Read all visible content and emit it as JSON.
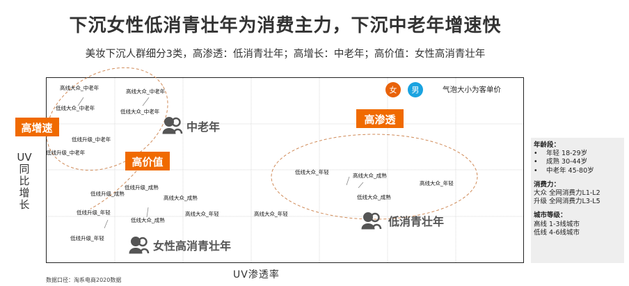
{
  "title": "下沉女性低消青壮年为消费主力，下沉中老年增速快",
  "subtitle": "美妆下沉人群细分3类，高渗透：低消青壮年；高增长：中老年；高价值：女性高消青壮年",
  "source": "数据口径：淘系电商2020数据",
  "chart_data": {
    "type": "scatter",
    "xlabel": "UV渗透率",
    "ylabel": "UV同比增长",
    "note": "气泡大小为客单价",
    "legend": [
      {
        "label": "女",
        "color": "#e8620a"
      },
      {
        "label": "男",
        "color": "#1aa3e0"
      }
    ],
    "points": [
      {
        "label": "高线大众_中老年"
      },
      {
        "label": "高线大众_中老年"
      },
      {
        "label": "低线大众_中老年"
      },
      {
        "label": "低线大众_中老年"
      },
      {
        "label": "低线升级_中老年"
      },
      {
        "label": "低线升级_中老年"
      },
      {
        "label": "低线升级_成熟"
      },
      {
        "label": "低线升级_成熟"
      },
      {
        "label": "高线大众_成熟"
      },
      {
        "label": "低线升级_年轻"
      },
      {
        "label": "高线大众_年轻"
      },
      {
        "label": "高线大众_年轻"
      },
      {
        "label": "低线大众_成熟"
      },
      {
        "label": "低线升级_年轻"
      },
      {
        "label": "低线大众_年轻"
      },
      {
        "label": "高线大众_成熟"
      },
      {
        "label": "高线大众_年轻"
      },
      {
        "label": "低线大众_成熟"
      }
    ],
    "groups": [
      {
        "tag": "高增速",
        "name": "中老年"
      },
      {
        "tag": "高渗透",
        "name": "低消青壮年"
      },
      {
        "tag": "高价值",
        "name": "女性高消青壮年"
      }
    ]
  },
  "panel": {
    "age_title": "年龄段：",
    "age_items": [
      "年轻 18-29岁",
      "成熟 30-44岁",
      "中老年 45-80岁"
    ],
    "spend_title": "消费力：",
    "spend_items": [
      "大众 全网消费力L1-L2",
      "升级 全网消费力L3-L5"
    ],
    "city_title": "城市等级：",
    "city_items": [
      "高线 1-3线城市",
      "低线 4-6线城市"
    ]
  },
  "colors": {
    "tag_bg": "#f06a00",
    "ellipse": "#d08a57",
    "icon": "#555555"
  }
}
